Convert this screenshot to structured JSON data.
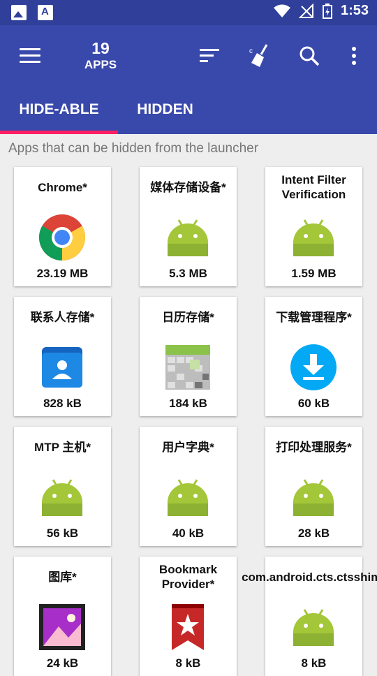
{
  "status_bar": {
    "time": "1:53"
  },
  "app_bar": {
    "count_number": "19",
    "count_label": "APPS",
    "icons": [
      "menu-icon",
      "sort-icon",
      "clean-icon",
      "search-icon",
      "more-vert-icon"
    ]
  },
  "tabs": [
    {
      "label": "HIDE-ABLE",
      "active": true
    },
    {
      "label": "HIDDEN",
      "active": false
    }
  ],
  "subtitle": "Apps that can be hidden from the launcher",
  "colors": {
    "primary": "#3949ab",
    "status_bar": "#2f3f9a",
    "accent": "#ff1f63",
    "android_green": "#a4c639"
  },
  "apps": [
    {
      "name": "Chrome*",
      "size": "23.19 MB",
      "icon": "chrome-icon"
    },
    {
      "name": "媒体存储设备*",
      "size": "5.3 MB",
      "icon": "android-icon"
    },
    {
      "name": "Intent Filter Verification",
      "size": "1.59 MB",
      "icon": "android-icon"
    },
    {
      "name": "联系人存储*",
      "size": "828 kB",
      "icon": "contacts-icon"
    },
    {
      "name": "日历存储*",
      "size": "184 kB",
      "icon": "calendar-icon"
    },
    {
      "name": "下载管理程序*",
      "size": "60 kB",
      "icon": "download-icon"
    },
    {
      "name": "MTP 主机*",
      "size": "56 kB",
      "icon": "android-icon"
    },
    {
      "name": "用户字典*",
      "size": "40 kB",
      "icon": "android-icon"
    },
    {
      "name": "打印处理服务*",
      "size": "28 kB",
      "icon": "android-icon"
    },
    {
      "name": "图库*",
      "size": "24 kB",
      "icon": "gallery-icon"
    },
    {
      "name": "Bookmark Provider*",
      "size": "8 kB",
      "icon": "bookmark-icon"
    },
    {
      "name": "com.android.cts.ctsshim*",
      "size": "8 kB",
      "icon": "android-icon"
    }
  ]
}
